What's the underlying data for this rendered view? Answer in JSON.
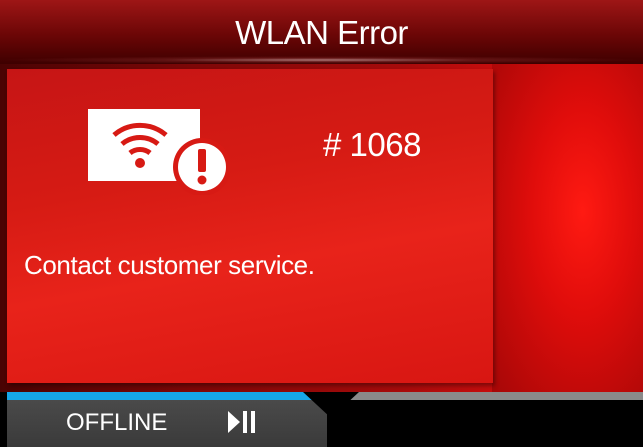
{
  "header": {
    "title": "WLAN Error"
  },
  "error": {
    "code": "# 1068",
    "message": "Contact customer service.",
    "icon": "wlan-warning-icon"
  },
  "status": {
    "mode": "OFFLINE",
    "play_pause_icon": "play-pause-icon"
  },
  "colors": {
    "accent_progress": "#16a6e8",
    "error_red": "#e8231a"
  }
}
